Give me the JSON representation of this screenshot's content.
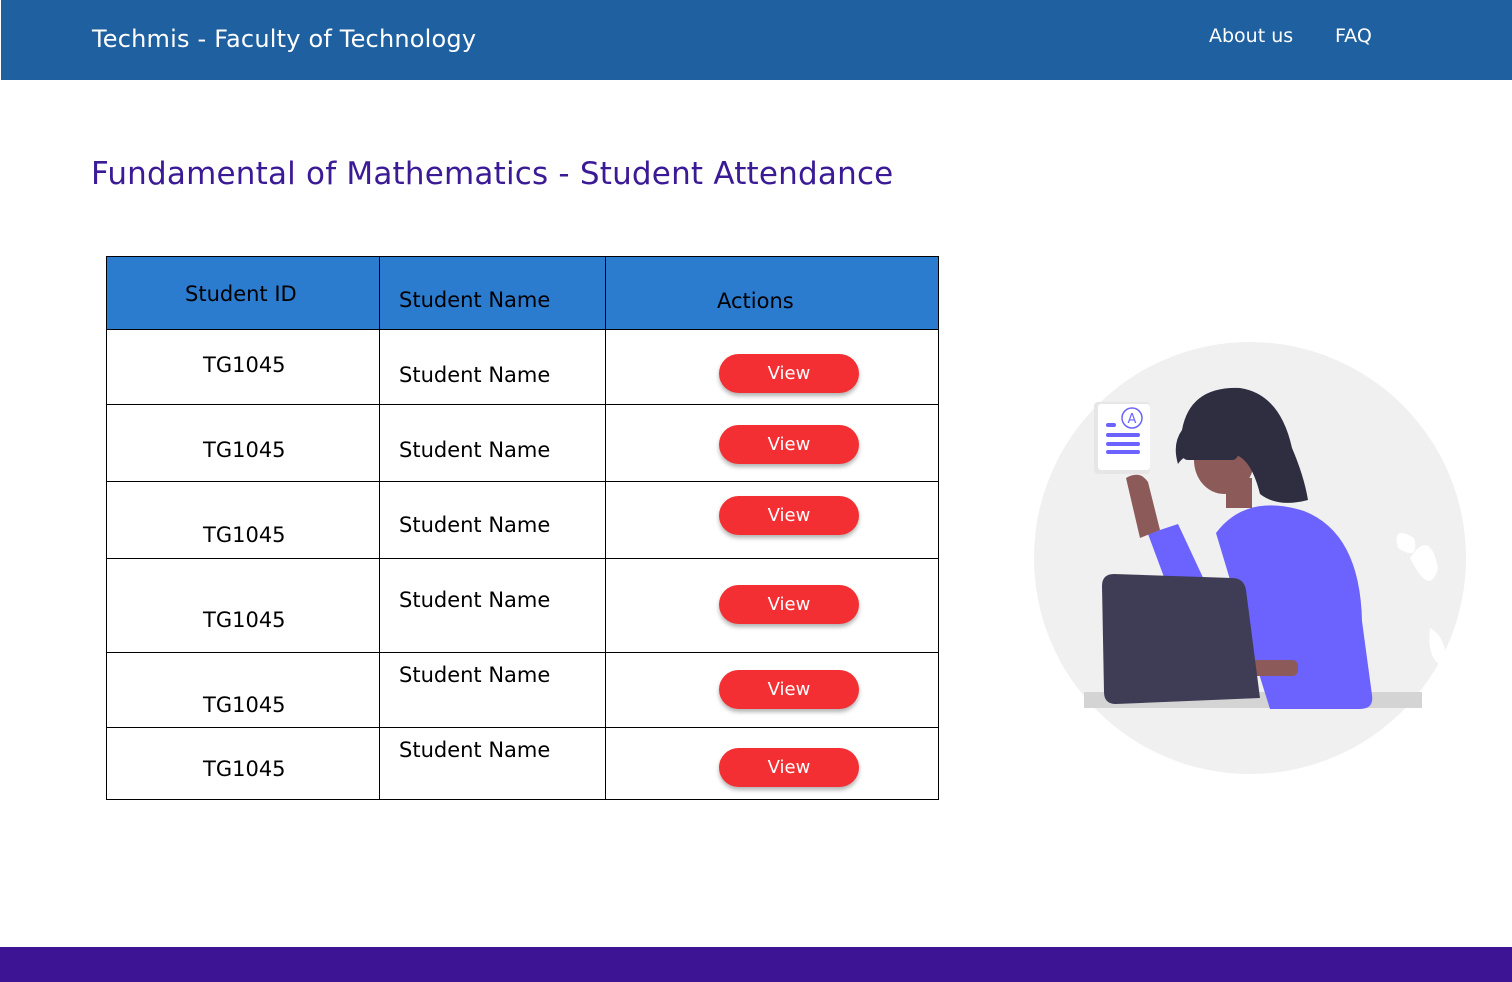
{
  "header": {
    "brand": "Techmis - Faculty of Technology",
    "nav": {
      "about": "About us",
      "faq": "FAQ"
    }
  },
  "page": {
    "title": "Fundamental of Mathematics - Student Attendance"
  },
  "table": {
    "columns": {
      "id": "Student  ID",
      "name": "Student  Name",
      "actions": "Actions"
    },
    "rows": [
      {
        "id": "TG1045",
        "name": "Student  Name",
        "action": "View"
      },
      {
        "id": "TG1045",
        "name": "Student  Name",
        "action": "View"
      },
      {
        "id": "TG1045",
        "name": "Student  Name",
        "action": "View"
      },
      {
        "id": "TG1045",
        "name": "Student  Name",
        "action": "View"
      },
      {
        "id": "TG1045",
        "name": "Student  Name",
        "action": "View"
      },
      {
        "id": "TG1045",
        "name": "Student  Name",
        "action": "View"
      }
    ]
  },
  "colors": {
    "header_bg": "#1f60a0",
    "title": "#3b1a96",
    "table_header_bg": "#2b7bcf",
    "view_button": "#f42f33",
    "footer_bg": "#3d1493"
  },
  "illustration": {
    "icon": "student-with-laptop-illustration",
    "card_letter": "A"
  }
}
